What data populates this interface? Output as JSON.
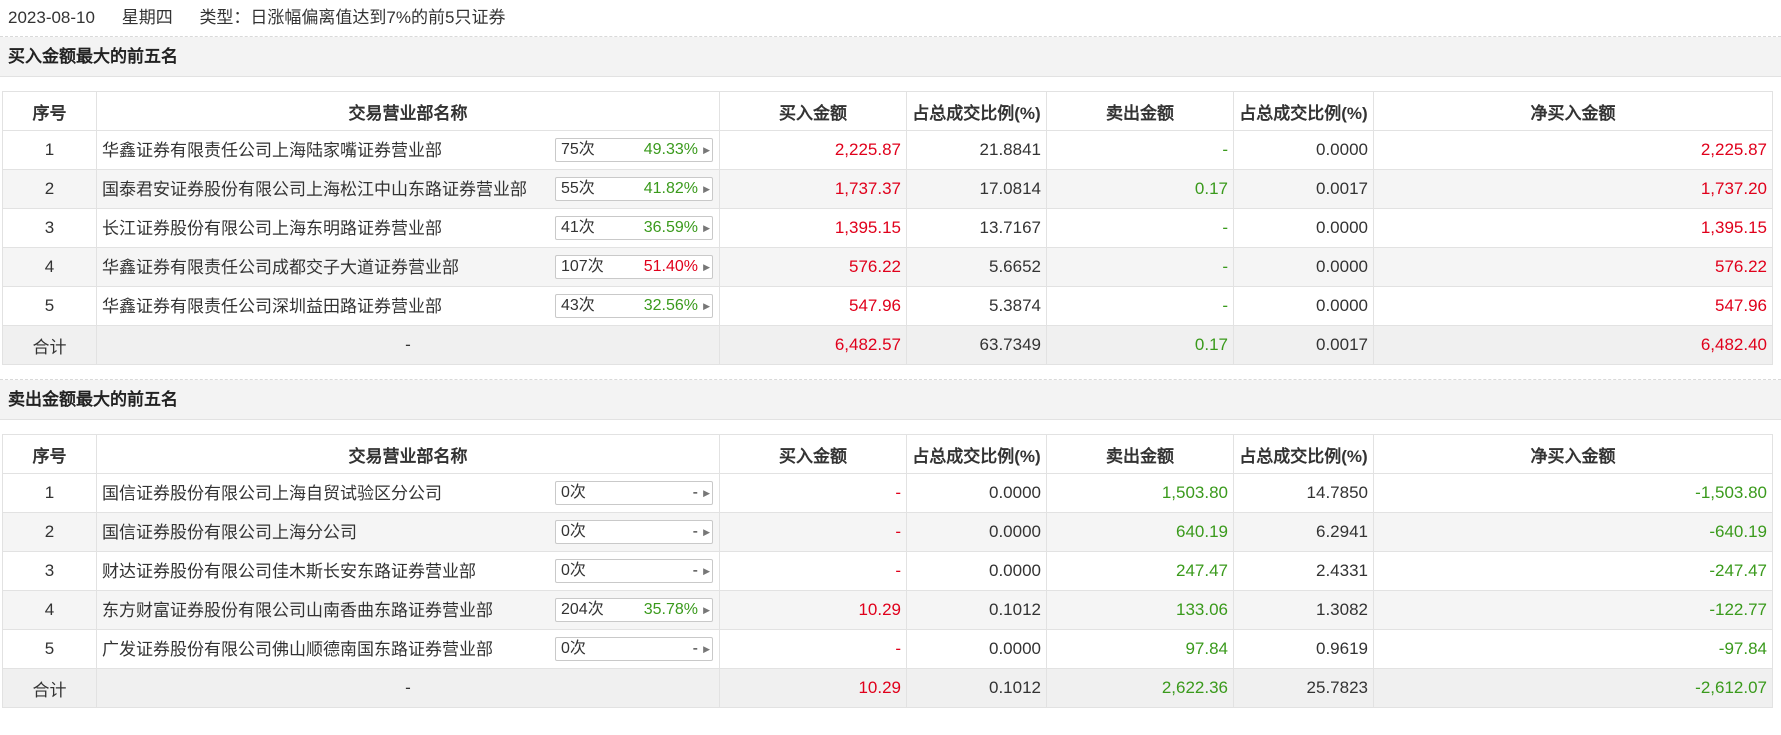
{
  "header": {
    "date": "2023-08-10",
    "weekday": "星期四",
    "type_text": "类型：日涨幅偏离值达到7%的前5只证券"
  },
  "columns": [
    "序号",
    "交易营业部名称",
    "买入金额",
    "占总成交比例(%)",
    "卖出金额",
    "占总成交比例(%)",
    "净买入金额"
  ],
  "colors": {
    "up": "#e0001b",
    "down": "#3a9a1c",
    "neutral": "#333333"
  },
  "buy_section": {
    "title": "买入金额最大的前五名",
    "rows": [
      {
        "idx": "1",
        "name": "华鑫证券有限责任公司上海陆家嘴证券营业部",
        "count": "75次",
        "rate": "49.33%",
        "rate_color": "green",
        "buy": "2,225.87",
        "buy_color": "red",
        "buy_pct": "21.8841",
        "sell": "-",
        "sell_color": "green",
        "sell_pct": "0.0000",
        "net": "2,225.87",
        "net_color": "red"
      },
      {
        "idx": "2",
        "name": "国泰君安证券股份有限公司上海松江中山东路证券营业部",
        "count": "55次",
        "rate": "41.82%",
        "rate_color": "green",
        "buy": "1,737.37",
        "buy_color": "red",
        "buy_pct": "17.0814",
        "sell": "0.17",
        "sell_color": "green",
        "sell_pct": "0.0017",
        "net": "1,737.20",
        "net_color": "red"
      },
      {
        "idx": "3",
        "name": "长江证券股份有限公司上海东明路证券营业部",
        "count": "41次",
        "rate": "36.59%",
        "rate_color": "green",
        "buy": "1,395.15",
        "buy_color": "red",
        "buy_pct": "13.7167",
        "sell": "-",
        "sell_color": "green",
        "sell_pct": "0.0000",
        "net": "1,395.15",
        "net_color": "red"
      },
      {
        "idx": "4",
        "name": "华鑫证券有限责任公司成都交子大道证券营业部",
        "count": "107次",
        "rate": "51.40%",
        "rate_color": "red",
        "buy": "576.22",
        "buy_color": "red",
        "buy_pct": "5.6652",
        "sell": "-",
        "sell_color": "green",
        "sell_pct": "0.0000",
        "net": "576.22",
        "net_color": "red"
      },
      {
        "idx": "5",
        "name": "华鑫证券有限责任公司深圳益田路证券营业部",
        "count": "43次",
        "rate": "32.56%",
        "rate_color": "green",
        "buy": "547.96",
        "buy_color": "red",
        "buy_pct": "5.3874",
        "sell": "-",
        "sell_color": "green",
        "sell_pct": "0.0000",
        "net": "547.96",
        "net_color": "red"
      }
    ],
    "total": {
      "label": "合计",
      "name": "-",
      "buy": "6,482.57",
      "buy_color": "red",
      "buy_pct": "63.7349",
      "sell": "0.17",
      "sell_color": "green",
      "sell_pct": "0.0017",
      "net": "6,482.40",
      "net_color": "red"
    }
  },
  "sell_section": {
    "title": "卖出金额最大的前五名",
    "rows": [
      {
        "idx": "1",
        "name": "国信证券股份有限公司上海自贸试验区分公司",
        "count": "0次",
        "rate": "-",
        "rate_color": "neutral",
        "buy": "-",
        "buy_color": "red",
        "buy_pct": "0.0000",
        "sell": "1,503.80",
        "sell_color": "green",
        "sell_pct": "14.7850",
        "net": "-1,503.80",
        "net_color": "green"
      },
      {
        "idx": "2",
        "name": "国信证券股份有限公司上海分公司",
        "count": "0次",
        "rate": "-",
        "rate_color": "neutral",
        "buy": "-",
        "buy_color": "red",
        "buy_pct": "0.0000",
        "sell": "640.19",
        "sell_color": "green",
        "sell_pct": "6.2941",
        "net": "-640.19",
        "net_color": "green"
      },
      {
        "idx": "3",
        "name": "财达证券股份有限公司佳木斯长安东路证券营业部",
        "count": "0次",
        "rate": "-",
        "rate_color": "neutral",
        "buy": "-",
        "buy_color": "red",
        "buy_pct": "0.0000",
        "sell": "247.47",
        "sell_color": "green",
        "sell_pct": "2.4331",
        "net": "-247.47",
        "net_color": "green"
      },
      {
        "idx": "4",
        "name": "东方财富证券股份有限公司山南香曲东路证券营业部",
        "count": "204次",
        "rate": "35.78%",
        "rate_color": "green",
        "buy": "10.29",
        "buy_color": "red",
        "buy_pct": "0.1012",
        "sell": "133.06",
        "sell_color": "green",
        "sell_pct": "1.3082",
        "net": "-122.77",
        "net_color": "green"
      },
      {
        "idx": "5",
        "name": "广发证券股份有限公司佛山顺德南国东路证券营业部",
        "count": "0次",
        "rate": "-",
        "rate_color": "neutral",
        "buy": "-",
        "buy_color": "red",
        "buy_pct": "0.0000",
        "sell": "97.84",
        "sell_color": "green",
        "sell_pct": "0.9619",
        "net": "-97.84",
        "net_color": "green"
      }
    ],
    "total": {
      "label": "合计",
      "name": "-",
      "buy": "10.29",
      "buy_color": "red",
      "buy_pct": "0.1012",
      "sell": "2,622.36",
      "sell_color": "green",
      "sell_pct": "25.7823",
      "net": "-2,612.07",
      "net_color": "green"
    }
  }
}
